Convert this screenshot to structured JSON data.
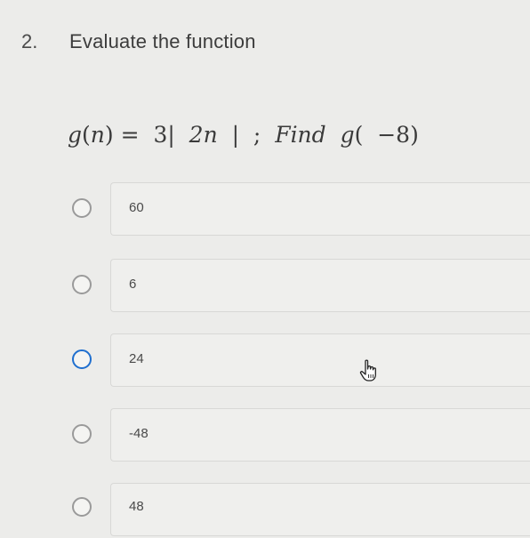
{
  "question": {
    "number": "2.",
    "title": "Evaluate the function",
    "formula": {
      "g": "g",
      "lparen": "(",
      "n": "n",
      "rparen_eq": ") =  ",
      "three": "3|  ",
      "two_n": "2n",
      "bar_semicolon": "  |  ;  ",
      "find": "Find",
      "g2": "  g",
      "arg": "(  −8)"
    }
  },
  "options": [
    {
      "label": "60"
    },
    {
      "label": "6"
    },
    {
      "label": "24"
    },
    {
      "label": "-48"
    },
    {
      "label": "48"
    }
  ],
  "colors": {
    "radio_border": "#9a9a9a",
    "radio_hover": "#1f6fcf",
    "background": "#ececea"
  },
  "icons": {
    "cursor": "hand-pointer-icon"
  }
}
